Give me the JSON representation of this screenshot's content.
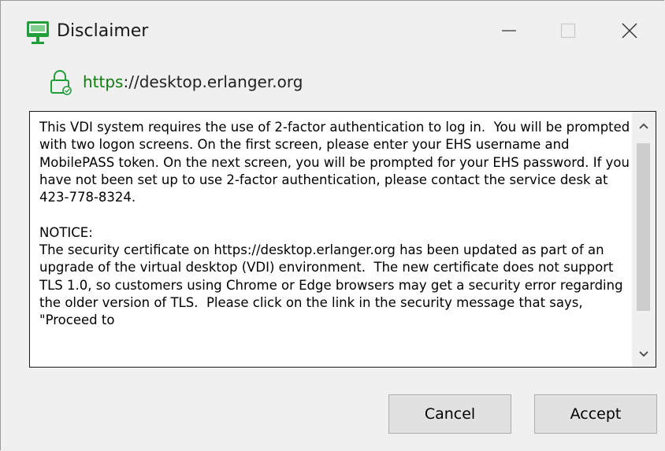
{
  "window": {
    "title": "Disclaimer",
    "icons": {
      "app": "remote-desktop-monitor-icon",
      "minimize": "minimize-icon",
      "maximize": "maximize-icon",
      "close": "close-icon"
    }
  },
  "address": {
    "icon": "lock-icon",
    "protocol": "https",
    "rest": "://desktop.erlanger.org"
  },
  "message": {
    "text": "This VDI system requires the use of 2-factor authentication to log in.  You will be prompted with two logon screens. On the first screen, please enter your EHS username and MobilePASS token. On the next screen, you will be prompted for your EHS password. If you have not been set up to use 2-factor authentication, please contact the service desk at 423-778-8324.\n\nNOTICE:\nThe security certificate on https://desktop.erlanger.org has been updated as part of an upgrade of the virtual desktop (VDI) environment.  The new certificate does not support TLS 1.0, so customers using Chrome or Edge browsers may get a security error regarding the older version of TLS.  Please click on the link in the security message that says, \"Proceed to"
  },
  "buttons": {
    "cancel": "Cancel",
    "accept": "Accept"
  },
  "colors": {
    "url_protocol": "#0f7b0f",
    "button_bg": "#e1e1e1",
    "window_bg": "#f0f0f0",
    "app_icon": "#1f9e3a"
  }
}
